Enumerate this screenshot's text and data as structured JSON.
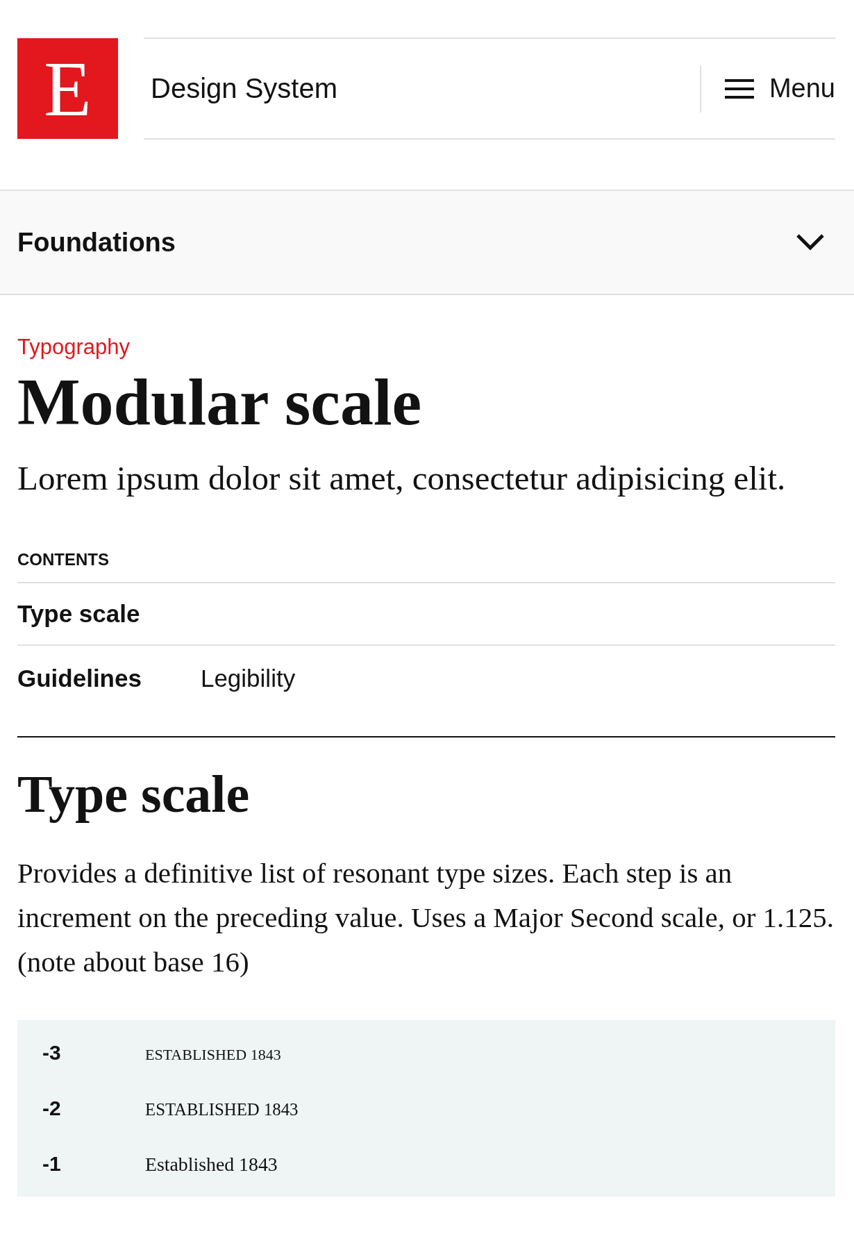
{
  "header": {
    "logo_letter": "E",
    "title": "Design System",
    "menu_label": "Menu"
  },
  "section_bar": {
    "label": "Foundations",
    "expanded": false
  },
  "page": {
    "eyebrow": "Typography",
    "title": "Modular scale",
    "intro": "Lorem ipsum dolor sit amet, consectetur adipisicing elit."
  },
  "contents": {
    "heading": "CONTENTS",
    "rows": [
      {
        "label": "Type scale",
        "links": []
      },
      {
        "label": "Guidelines",
        "links": [
          "Legibility"
        ]
      }
    ]
  },
  "section": {
    "title": "Type scale",
    "body": "Provides a definitive list of resonant type sizes. Each step is an increment on the preceding value. Uses a Major Second scale, or 1.125. (note about base 16)"
  },
  "scale_rows": [
    {
      "step": "-3",
      "sample": "ESTABLISHED 1843"
    },
    {
      "step": "-2",
      "sample": "ESTABLISHED 1843"
    },
    {
      "step": "-1",
      "sample": "Established 1843"
    }
  ]
}
